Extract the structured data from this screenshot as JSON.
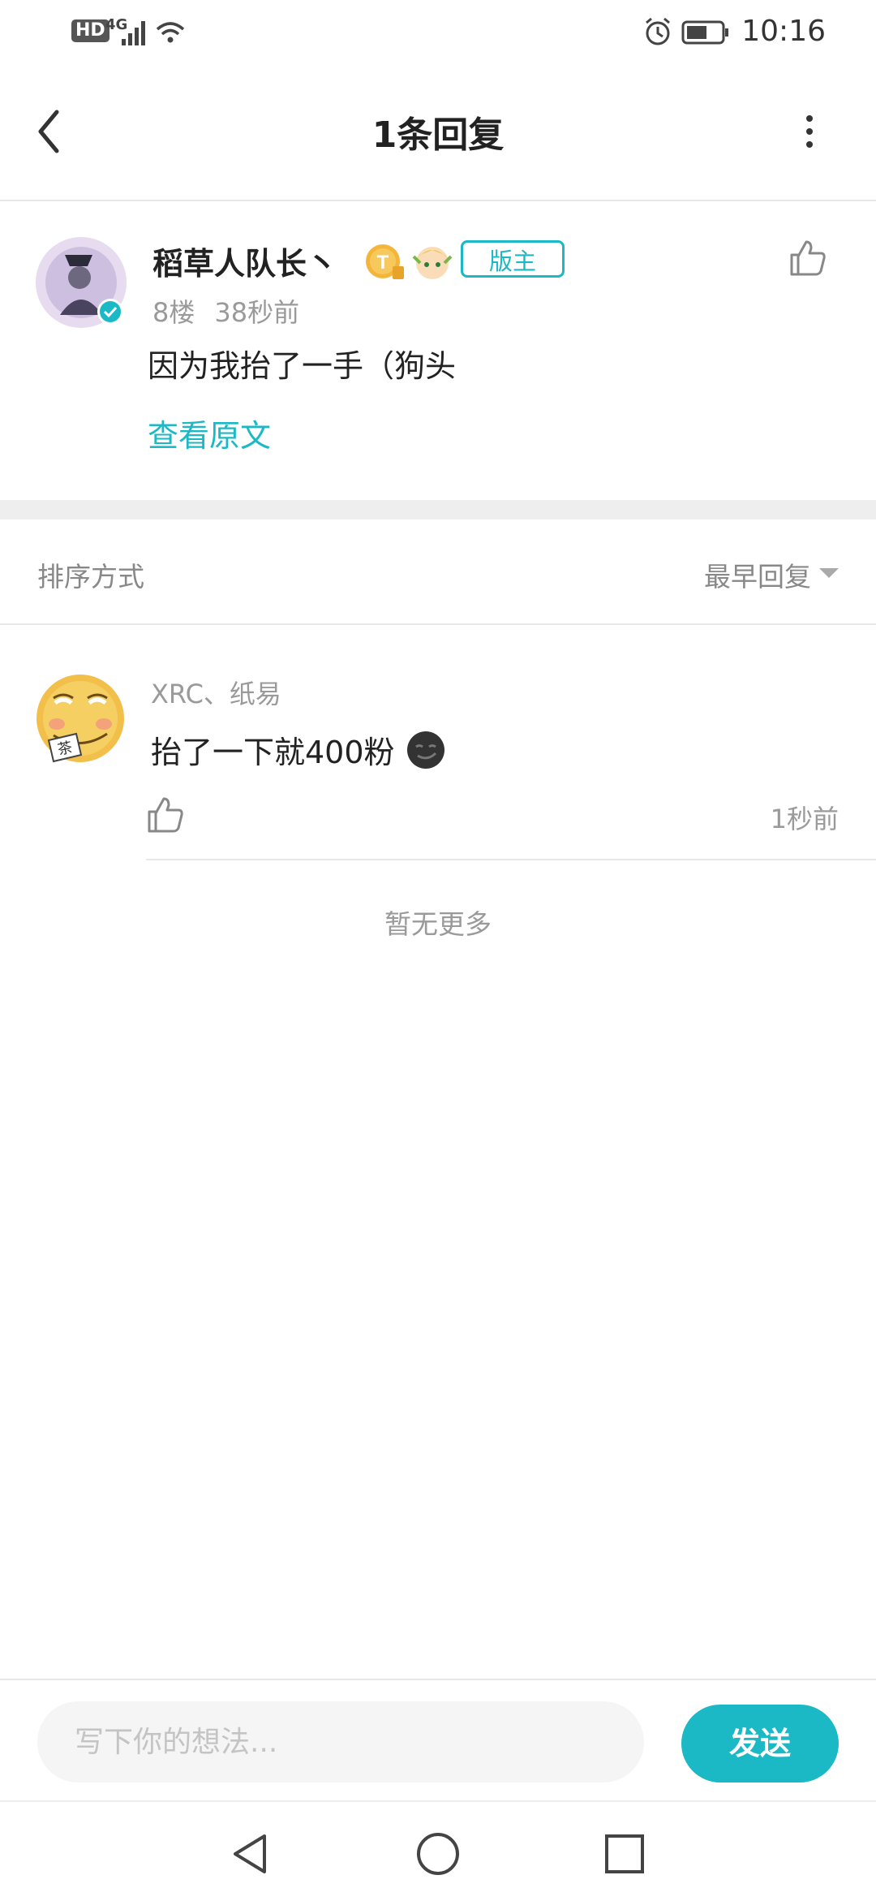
{
  "status_bar": {
    "network_hd": "HD",
    "network_gen": "4G",
    "time": "10:16"
  },
  "header": {
    "title": "1条回复"
  },
  "post": {
    "author": "稻草人队长丶",
    "level_badge": "T",
    "role_badge": "版主",
    "floor": "8楼",
    "time_ago": "38秒前",
    "content": "因为我抬了一手（狗头",
    "view_original": "查看原文"
  },
  "sort": {
    "label": "排序方式",
    "value": "最早回复"
  },
  "replies": [
    {
      "author": "XRC、纸易",
      "content": "抬了一下就400粉",
      "time_ago": "1秒前",
      "avatar_text": "茶"
    }
  ],
  "no_more": "暂无更多",
  "composer": {
    "placeholder": "写下你的想法...",
    "send_label": "发送"
  },
  "colors": {
    "accent": "#1bb8c5",
    "muted": "#9a9a9a"
  }
}
